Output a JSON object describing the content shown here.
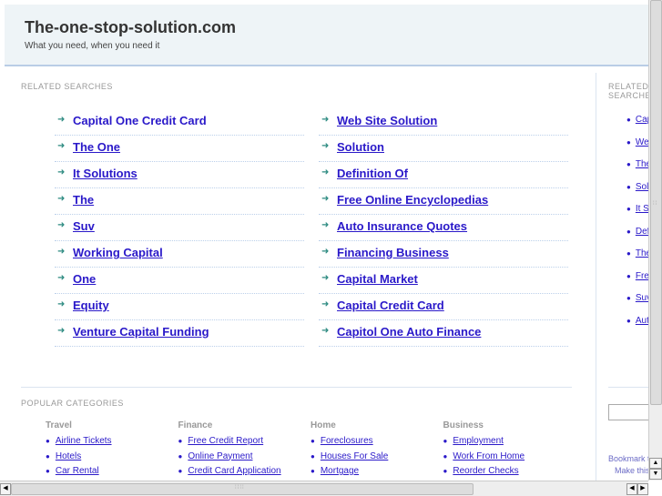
{
  "header": {
    "title": "The-one-stop-solution.com",
    "tagline": "What you need, when you need it"
  },
  "related": {
    "title": "RELATED SEARCHES",
    "left": [
      "Capital One Credit Card",
      "The One",
      "It Solutions",
      "The",
      "Suv",
      "Working Capital",
      "One",
      "Equity",
      "Venture Capital Funding"
    ],
    "right": [
      "Web Site Solution",
      "Solution",
      "Definition Of",
      "Free Online Encyclopedias",
      "Auto Insurance Quotes",
      "Financing Business",
      "Capital Market",
      "Capital Credit Card",
      "Capitol One Auto Finance"
    ]
  },
  "popular": {
    "title": "POPULAR CATEGORIES",
    "categories": [
      {
        "name": "Travel",
        "links": [
          "Airline Tickets",
          "Hotels",
          "Car Rental"
        ]
      },
      {
        "name": "Finance",
        "links": [
          "Free Credit Report",
          "Online Payment",
          "Credit Card Application"
        ]
      },
      {
        "name": "Home",
        "links": [
          "Foreclosures",
          "Houses For Sale",
          "Mortgage"
        ]
      },
      {
        "name": "Business",
        "links": [
          "Employment",
          "Work From Home",
          "Reorder Checks"
        ]
      }
    ]
  },
  "sidebar": {
    "title": "RELATED SEARCHES",
    "items": [
      "Capital One Credit Card",
      "Web Site Solution",
      "The One",
      "Solution",
      "It Solutions",
      "Definition Of",
      "The",
      "Free Online Encyclopedias",
      "Suv",
      "Auto Insurance Quotes"
    ],
    "bookmark": "Bookmark this page",
    "make": "Make this your homepage"
  }
}
